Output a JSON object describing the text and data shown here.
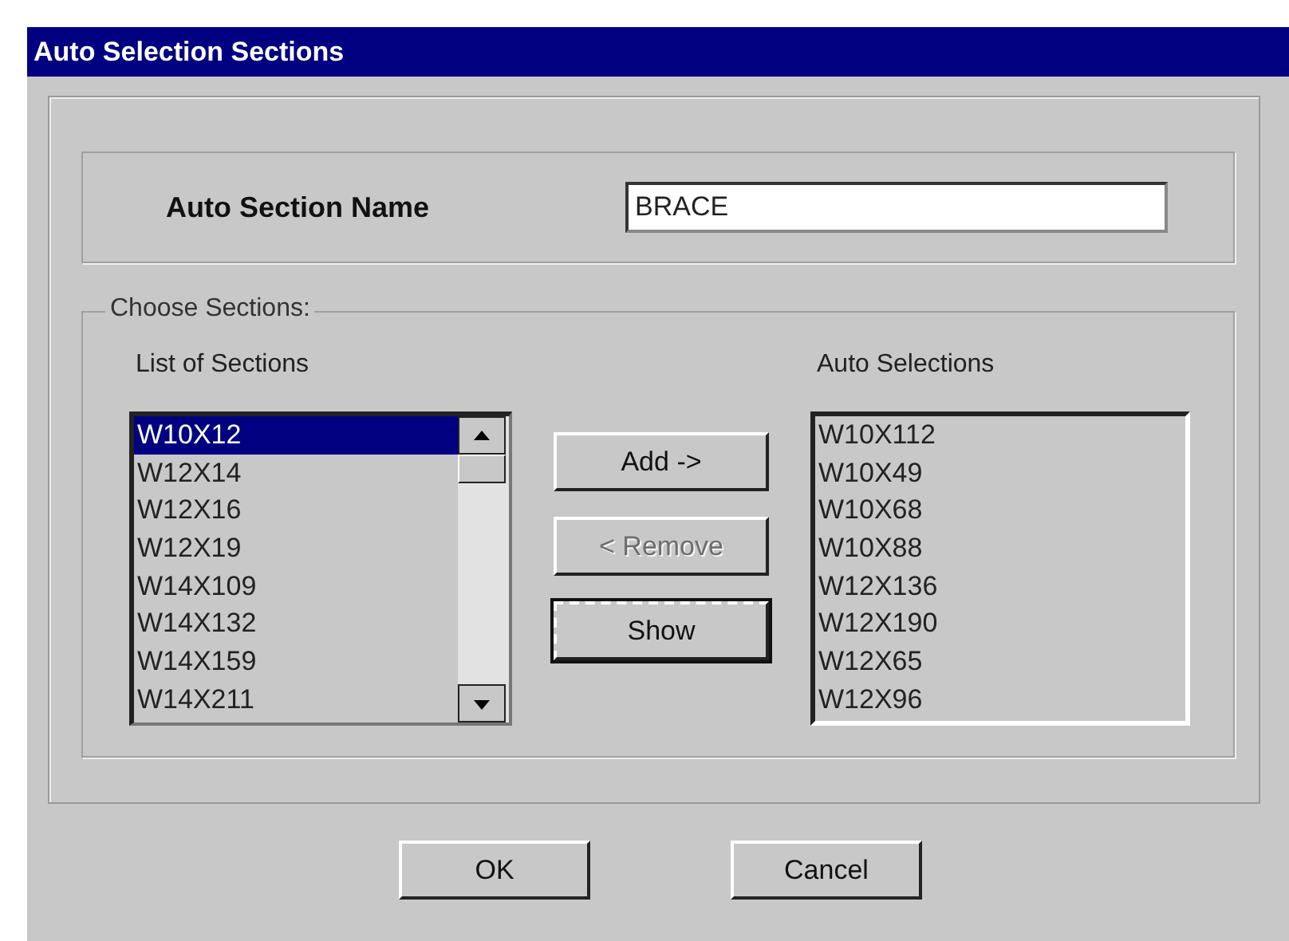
{
  "window": {
    "title": "Auto Selection Sections"
  },
  "name_field": {
    "label": "Auto Section Name",
    "value": "BRACE"
  },
  "choose_sections": {
    "title": "Choose Sections:",
    "list_of_sections": {
      "label": "List of Sections",
      "items": [
        {
          "label": "W10X12",
          "selected": true
        },
        {
          "label": "W12X14",
          "selected": false
        },
        {
          "label": "W12X16",
          "selected": false
        },
        {
          "label": "W12X19",
          "selected": false
        },
        {
          "label": "W14X109",
          "selected": false
        },
        {
          "label": "W14X132",
          "selected": false
        },
        {
          "label": "W14X159",
          "selected": false
        },
        {
          "label": "W14X211",
          "selected": false
        }
      ]
    },
    "actions": [
      {
        "label": "Add ->",
        "disabled": false,
        "focused": false
      },
      {
        "label": "< Remove",
        "disabled": true,
        "focused": false
      },
      {
        "label": "Show",
        "disabled": false,
        "focused": true
      }
    ],
    "auto_selections": {
      "label": "Auto Selections",
      "items": [
        {
          "label": "W10X112",
          "selected": false
        },
        {
          "label": "W10X49",
          "selected": false
        },
        {
          "label": "W10X68",
          "selected": false
        },
        {
          "label": "W10X88",
          "selected": false
        },
        {
          "label": "W12X136",
          "selected": false
        },
        {
          "label": "W12X190",
          "selected": false
        },
        {
          "label": "W12X65",
          "selected": false
        },
        {
          "label": "W12X96",
          "selected": false
        }
      ]
    }
  },
  "buttons": [
    "OK",
    "Cancel"
  ]
}
